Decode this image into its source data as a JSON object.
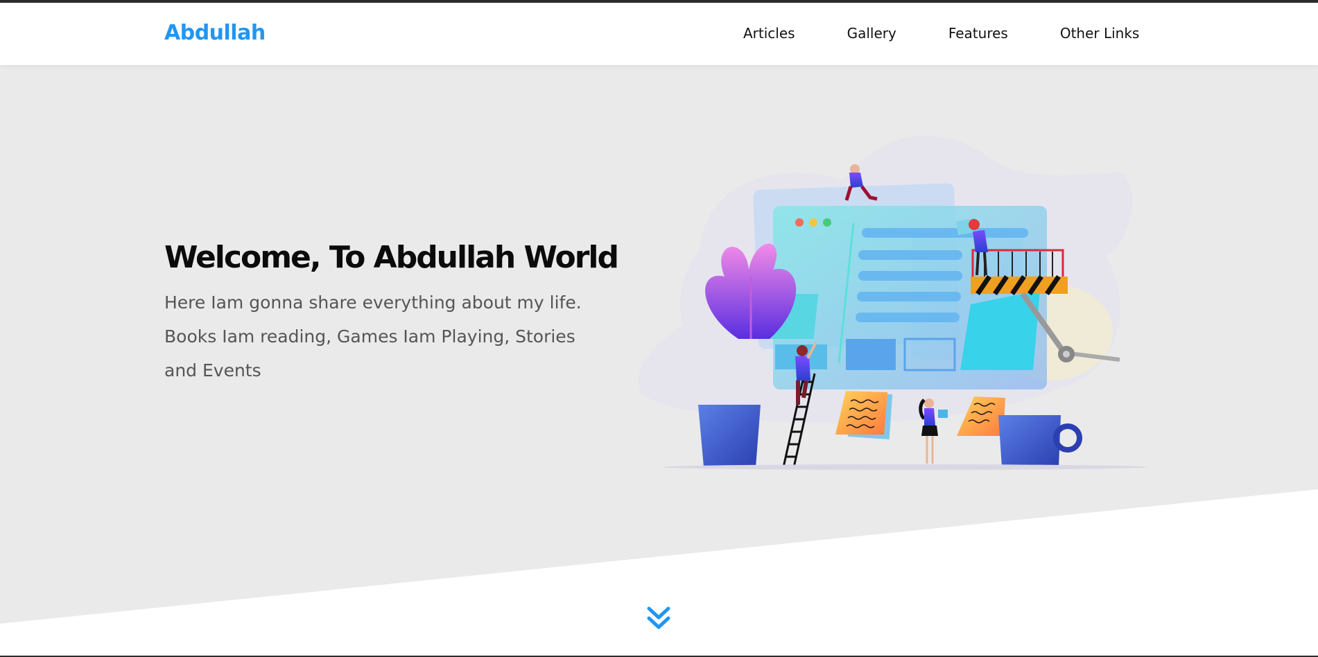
{
  "header": {
    "logo": "Abdullah",
    "nav": [
      {
        "label": "Articles"
      },
      {
        "label": "Gallery"
      },
      {
        "label": "Features"
      },
      {
        "label": "Other Links"
      }
    ]
  },
  "hero": {
    "title": "Welcome, To Abdullah World",
    "text": "Here Iam gonna share everything about my life. Books Iam reading, Games Iam Playing, Stories and Events"
  },
  "colors": {
    "accent": "#2196f3",
    "hero_bg": "#eaeaea",
    "title": "#0b0b0b",
    "text": "#555555"
  },
  "icons": {
    "scroll_down": "double-chevron-down-icon"
  }
}
